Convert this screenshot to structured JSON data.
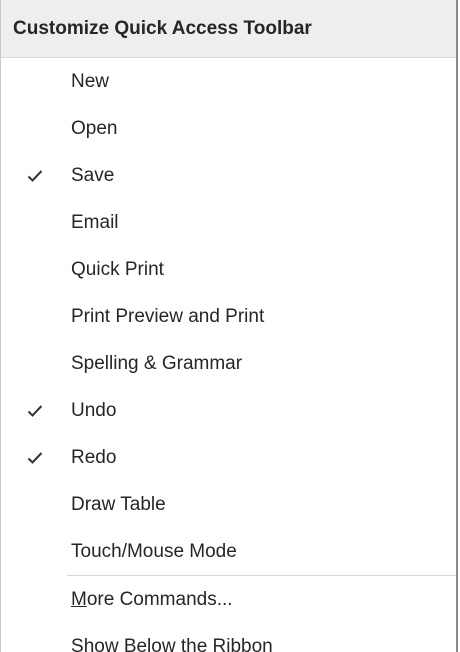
{
  "menu": {
    "title": "Customize Quick Access Toolbar",
    "items": [
      {
        "label": "New",
        "checked": false
      },
      {
        "label": "Open",
        "checked": false
      },
      {
        "label": "Save",
        "checked": true
      },
      {
        "label": "Email",
        "checked": false
      },
      {
        "label": "Quick Print",
        "checked": false
      },
      {
        "label": "Print Preview and Print",
        "checked": false
      },
      {
        "label": "Spelling & Grammar",
        "checked": false
      },
      {
        "label": "Undo",
        "checked": true
      },
      {
        "label": "Redo",
        "checked": true
      },
      {
        "label": "Draw Table",
        "checked": false
      },
      {
        "label": "Touch/Mouse Mode",
        "checked": false
      }
    ],
    "more_commands": {
      "accel": "M",
      "rest": "ore Commands..."
    },
    "show_below": {
      "accel": "S",
      "rest": "how Below the Ribbon"
    }
  },
  "icons": {
    "check": "check-icon"
  }
}
